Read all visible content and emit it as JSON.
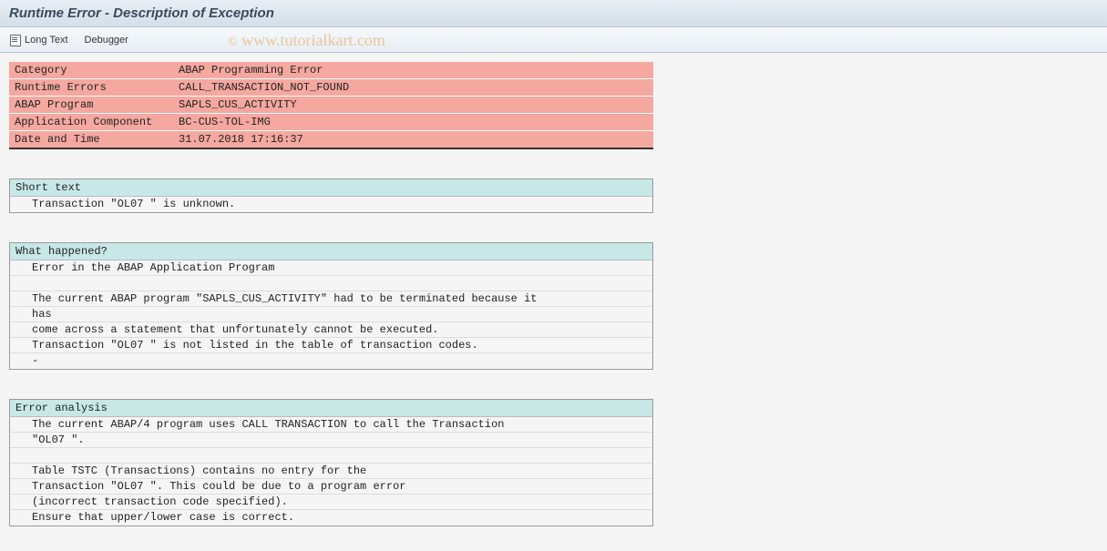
{
  "title": "Runtime Error - Description of Exception",
  "toolbar": {
    "long_text_label": "Long Text",
    "debugger_label": "Debugger"
  },
  "watermark": "© www.tutorialkart.com",
  "info_rows": [
    {
      "label": "Category",
      "value": "ABAP Programming Error"
    },
    {
      "label": "Runtime Errors",
      "value": "CALL_TRANSACTION_NOT_FOUND"
    },
    {
      "label": "ABAP Program",
      "value": "SAPLS_CUS_ACTIVITY"
    },
    {
      "label": "Application Component",
      "value": "BC-CUS-TOL-IMG"
    },
    {
      "label": "Date and Time",
      "value": "31.07.2018 17:16:37"
    }
  ],
  "sections": [
    {
      "header": "Short text",
      "lines": [
        "Transaction \"OL07 \" is unknown."
      ]
    },
    {
      "header": "What happened?",
      "lines": [
        "Error in the ABAP Application Program",
        "",
        "The current ABAP program \"SAPLS_CUS_ACTIVITY\" had to be terminated because it",
        " has",
        "come across a statement that unfortunately cannot be executed.",
        "Transaction \"OL07 \" is not listed in the table of transaction codes.",
        "-"
      ]
    },
    {
      "header": "Error analysis",
      "lines": [
        "The current ABAP/4 program uses CALL TRANSACTION to call the Transaction",
        "\"OL07 \".",
        "",
        "Table TSTC (Transactions) contains no entry for the",
        "Transaction \"OL07 \". This could be due to a program error",
        "(incorrect transaction code specified).",
        "Ensure that upper/lower case is correct."
      ]
    }
  ]
}
